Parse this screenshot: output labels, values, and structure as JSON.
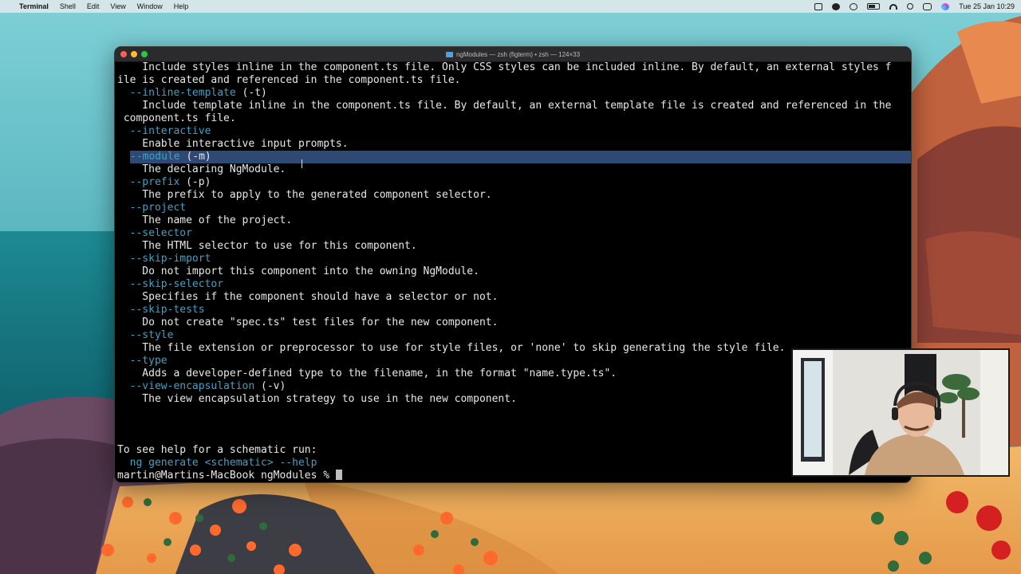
{
  "menubar": {
    "app_name": "Terminal",
    "items": [
      "Shell",
      "Edit",
      "View",
      "Window",
      "Help"
    ],
    "datetime": "Tue 25 Jan  10:29",
    "status_icons": [
      "sidebar-icon",
      "grammarly-icon",
      "volume-icon",
      "battery-icon",
      "wifi-icon",
      "search-icon",
      "control-center-icon",
      "siri-icon"
    ]
  },
  "window": {
    "title": "ngModules — zsh (figterm) • zsh — 124×33"
  },
  "terminal": {
    "lines": [
      {
        "text": "    Include styles inline in the component.ts file. Only CSS styles can be included inline. By default, an external styles f"
      },
      {
        "text": "ile is created and referenced in the component.ts file."
      },
      {
        "flag": "--inline-template",
        "suffix": " (-t)"
      },
      {
        "text": "    Include template inline in the component.ts file. By default, an external template file is created and referenced in the"
      },
      {
        "text": " component.ts file."
      },
      {
        "flag": "--interactive",
        "suffix": ""
      },
      {
        "text": "    Enable interactive input prompts."
      },
      {
        "flag": "--module",
        "suffix": " (-m)",
        "selected": true
      },
      {
        "text": "    The declaring NgModule."
      },
      {
        "flag": "--prefix",
        "suffix": " (-p)"
      },
      {
        "text": "    The prefix to apply to the generated component selector."
      },
      {
        "flag": "--project",
        "suffix": ""
      },
      {
        "text": "    The name of the project."
      },
      {
        "flag": "--selector",
        "suffix": ""
      },
      {
        "text": "    The HTML selector to use for this component."
      },
      {
        "flag": "--skip-import",
        "suffix": ""
      },
      {
        "text": "    Do not import this component into the owning NgModule."
      },
      {
        "flag": "--skip-selector",
        "suffix": ""
      },
      {
        "text": "    Specifies if the component should have a selector or not."
      },
      {
        "flag": "--skip-tests",
        "suffix": ""
      },
      {
        "text": "    Do not create \"spec.ts\" test files for the new component."
      },
      {
        "flag": "--style",
        "suffix": ""
      },
      {
        "text": "    The file extension or preprocessor to use for style files, or 'none' to skip generating the style file."
      },
      {
        "flag": "--type",
        "suffix": ""
      },
      {
        "text": "    Adds a developer-defined type to the filename, in the format \"name.type.ts\"."
      },
      {
        "flag": "--view-encapsulation",
        "suffix": " (-v)"
      },
      {
        "text": "    The view encapsulation strategy to use in the new component."
      },
      {
        "text": ""
      },
      {
        "text": ""
      },
      {
        "text": ""
      },
      {
        "text": "To see help for a schematic run:"
      },
      {
        "hint": "  ng generate <schematic> --help"
      },
      {
        "prompt": "martin@Martins-MacBook ngModules % "
      }
    ]
  },
  "colors": {
    "flag": "#3aa3c7",
    "selection": "#2e4a74",
    "terminal_bg": "#000000",
    "text": "#e8e8e8"
  }
}
